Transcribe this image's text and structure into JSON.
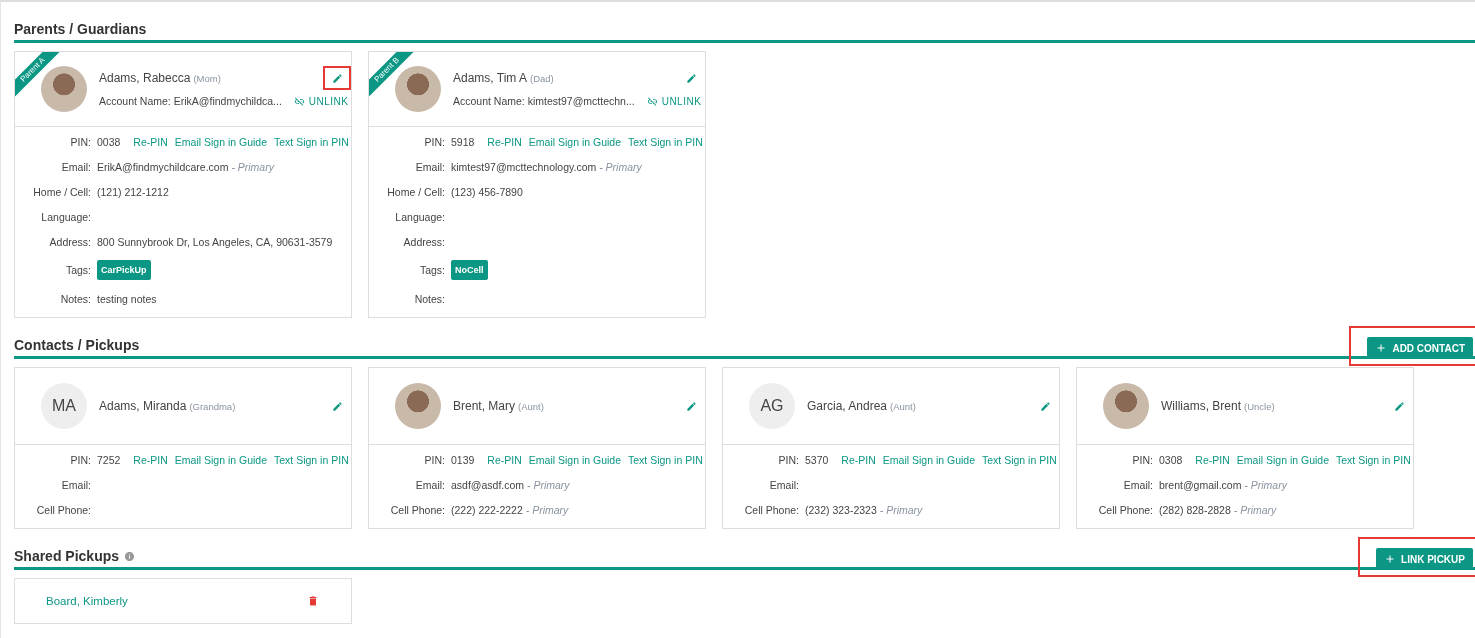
{
  "sections": [
    {
      "kind": "parents",
      "title": "Parents / Guardians",
      "cards": [
        {
          "ribbon": "Parent A",
          "avatar": {
            "kind": "photo"
          },
          "name": "Adams, Rabecca",
          "relation": "(Mom)",
          "edit_highlighted": true,
          "account_label": "Account Name:",
          "account": "ErikA@findmychildca...",
          "unlink": "UNLINK",
          "fields": [
            {
              "kind": "pin",
              "label": "PIN:",
              "value": "0038",
              "links": [
                "Re-PIN",
                "Email Sign in Guide",
                "Text Sign in PIN"
              ]
            },
            {
              "kind": "text",
              "label": "Email:",
              "value": "ErikA@findmychildcare.com",
              "note": "- Primary"
            },
            {
              "kind": "text",
              "label": "Home / Cell:",
              "value": "(121) 212-1212"
            },
            {
              "kind": "text",
              "label": "Language:"
            },
            {
              "kind": "text",
              "label": "Address:",
              "value": "800 Sunnybrook Dr, Los Angeles, CA, 90631-3579"
            },
            {
              "kind": "tags",
              "label": "Tags:",
              "tags": [
                "CarPickUp"
              ]
            },
            {
              "kind": "text",
              "label": "Notes:",
              "value": "testing notes"
            }
          ]
        },
        {
          "ribbon": "Parent B",
          "avatar": {
            "kind": "photo"
          },
          "name": "Adams, Tim A",
          "relation": "(Dad)",
          "edit_highlighted": false,
          "account_label": "Account Name:",
          "account": "kimtest97@mcttechn...",
          "unlink": "UNLINK",
          "fields": [
            {
              "kind": "pin",
              "label": "PIN:",
              "value": "5918",
              "links": [
                "Re-PIN",
                "Email Sign in Guide",
                "Text Sign in PIN"
              ]
            },
            {
              "kind": "text",
              "label": "Email:",
              "value": "kimtest97@mcttechnology.com",
              "note": "- Primary"
            },
            {
              "kind": "text",
              "label": "Home / Cell:",
              "value": "(123) 456-7890"
            },
            {
              "kind": "text",
              "label": "Language:"
            },
            {
              "kind": "text",
              "label": "Address:"
            },
            {
              "kind": "tags",
              "label": "Tags:",
              "tags": [
                "NoCell"
              ]
            },
            {
              "kind": "text",
              "label": "Notes:"
            }
          ]
        }
      ]
    },
    {
      "kind": "contacts",
      "title": "Contacts / Pickups",
      "button": {
        "label": "ADD CONTACT",
        "highlighted": true
      },
      "cards": [
        {
          "avatar": {
            "kind": "initials",
            "text": "MA"
          },
          "name": "Adams, Miranda",
          "relation": "(Grandma)",
          "edit_highlighted": false,
          "fields": [
            {
              "kind": "pin",
              "label": "PIN:",
              "value": "7252",
              "links": [
                "Re-PIN",
                "Email Sign in Guide",
                "Text Sign in PIN"
              ]
            },
            {
              "kind": "text",
              "label": "Email:"
            },
            {
              "kind": "text",
              "label": "Cell Phone:"
            }
          ]
        },
        {
          "avatar": {
            "kind": "photo"
          },
          "name": "Brent, Mary",
          "relation": "(Aunt)",
          "edit_highlighted": false,
          "fields": [
            {
              "kind": "pin",
              "label": "PIN:",
              "value": "0139",
              "links": [
                "Re-PIN",
                "Email Sign in Guide",
                "Text Sign in PIN"
              ]
            },
            {
              "kind": "text",
              "label": "Email:",
              "value": "asdf@asdf.com",
              "note": "- Primary"
            },
            {
              "kind": "text",
              "label": "Cell Phone:",
              "value": "(222) 222-2222",
              "note": "- Primary"
            }
          ]
        },
        {
          "avatar": {
            "kind": "initials",
            "text": "AG"
          },
          "name": "Garcia, Andrea",
          "relation": "(Aunt)",
          "edit_highlighted": false,
          "fields": [
            {
              "kind": "pin",
              "label": "PIN:",
              "value": "5370",
              "links": [
                "Re-PIN",
                "Email Sign in Guide",
                "Text Sign in PIN"
              ]
            },
            {
              "kind": "text",
              "label": "Email:"
            },
            {
              "kind": "text",
              "label": "Cell Phone:",
              "value": "(232) 323-2323",
              "note": "- Primary"
            }
          ]
        },
        {
          "avatar": {
            "kind": "photo"
          },
          "name": "Williams, Brent",
          "relation": "(Uncle)",
          "edit_highlighted": false,
          "fields": [
            {
              "kind": "pin",
              "label": "PIN:",
              "value": "0308",
              "links": [
                "Re-PIN",
                "Email Sign in Guide",
                "Text Sign in PIN"
              ]
            },
            {
              "kind": "text",
              "label": "Email:",
              "value": "brent@gmail.com",
              "note": "- Primary"
            },
            {
              "kind": "text",
              "label": "Cell Phone:",
              "value": "(282) 828-2828",
              "note": "- Primary"
            }
          ]
        }
      ]
    },
    {
      "kind": "shared",
      "title": "Shared Pickups",
      "info": true,
      "button": {
        "label": "LINK PICKUP",
        "highlighted": true
      },
      "items": [
        {
          "name": "Board, Kimberly"
        }
      ]
    }
  ]
}
